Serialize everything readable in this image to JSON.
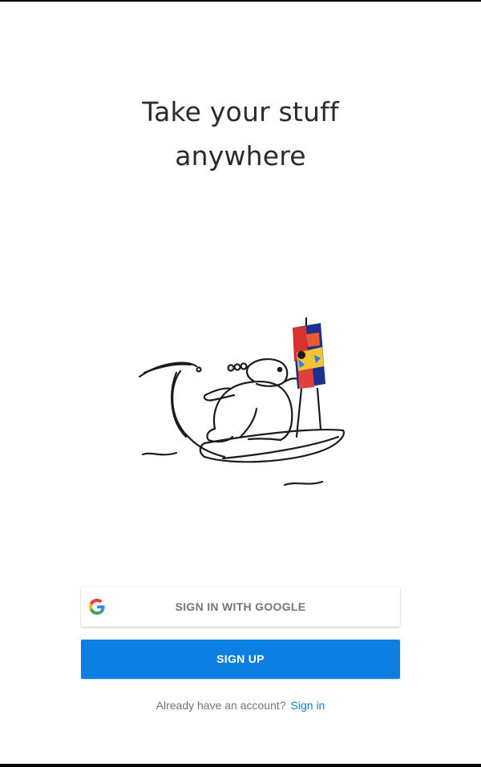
{
  "headline": {
    "line1": "Take your stuff",
    "line2": "anywhere"
  },
  "illustration": {
    "icon": "surfing-bear-painter-illustration"
  },
  "google_button": {
    "label": "SIGN IN WITH GOOGLE",
    "icon": "google-g-icon"
  },
  "signup_button": {
    "label": "SIGN UP"
  },
  "signin": {
    "prompt": "Already have an account?",
    "link": "Sign in"
  },
  "colors": {
    "accent": "#0d7fe3",
    "headline_text": "#2b2b2b",
    "muted_text": "#757575",
    "background": "#ffffff"
  }
}
